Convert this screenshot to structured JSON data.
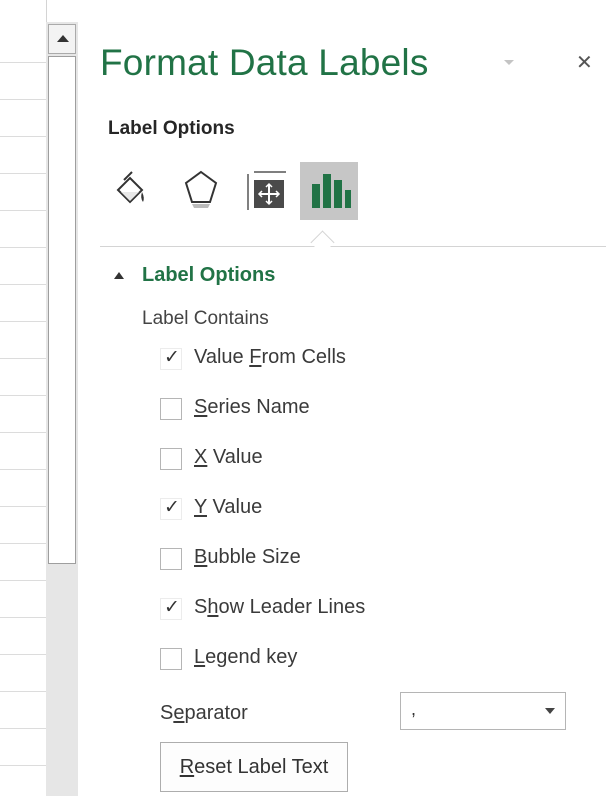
{
  "panel": {
    "title": "Format Data Labels",
    "subheading": "Label Options",
    "icons": [
      "fill-line-icon",
      "effects-icon",
      "size-properties-icon",
      "label-options-icon"
    ],
    "selected_icon": "label-options-icon",
    "accent_color": "#217346"
  },
  "section": {
    "title": "Label Options",
    "label_contains": "Label Contains",
    "options": [
      {
        "pre": "Value ",
        "u": "F",
        "post": "rom Cells",
        "checked": true
      },
      {
        "pre": "",
        "u": "S",
        "post": "eries Name",
        "checked": false
      },
      {
        "pre": "",
        "u": "X",
        "post": " Value",
        "checked": false
      },
      {
        "pre": "",
        "u": "Y",
        "post": " Value",
        "checked": true
      },
      {
        "pre": "",
        "u": "B",
        "post": "ubble Size",
        "checked": false
      },
      {
        "pre": "S",
        "u": "h",
        "post": "ow Leader Lines",
        "checked": true
      },
      {
        "pre": "",
        "u": "L",
        "post": "egend key",
        "checked": false
      }
    ],
    "separator": {
      "pre": "S",
      "u": "e",
      "post": "parator",
      "value": ","
    },
    "reset": {
      "pre": "",
      "u": "R",
      "post": "eset Label Text"
    }
  }
}
